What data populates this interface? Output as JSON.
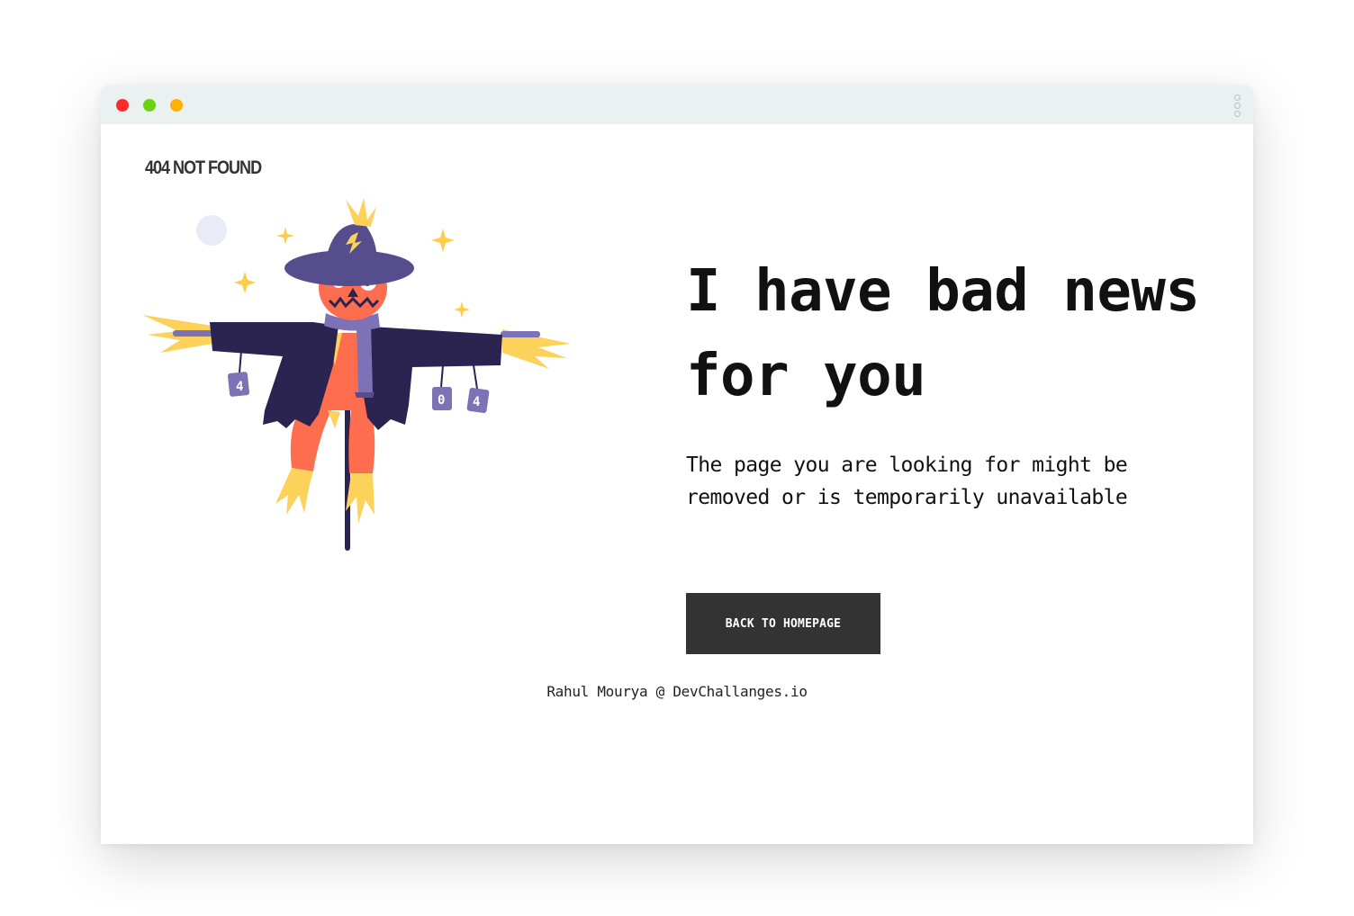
{
  "window": {
    "controls": [
      "close",
      "maximize",
      "minimize"
    ],
    "menu_icon": "kebab-menu-icon"
  },
  "brand": {
    "text": "404 NOT FOUND"
  },
  "hero": {
    "illustration": "scarecrow-illustration",
    "can_labels": [
      "4",
      "0",
      "4"
    ],
    "headline_line1": "I have bad news",
    "headline_line2": "for you",
    "description_line1": "The page you are looking for might be",
    "description_line2": "removed or is temporarily unavailable",
    "button_label": "BACK TO HOMEPAGE"
  },
  "footer": {
    "text": "Rahul Mourya @ DevChallanges.io"
  },
  "colors": {
    "button_bg": "#333333",
    "titlebar_bg": "#ebf0f0",
    "scarecrow_coat": "#2b2350",
    "scarecrow_hat": "#564e8c",
    "scarecrow_orange": "#ff6d4f",
    "straw_yellow": "#fcd25a"
  }
}
